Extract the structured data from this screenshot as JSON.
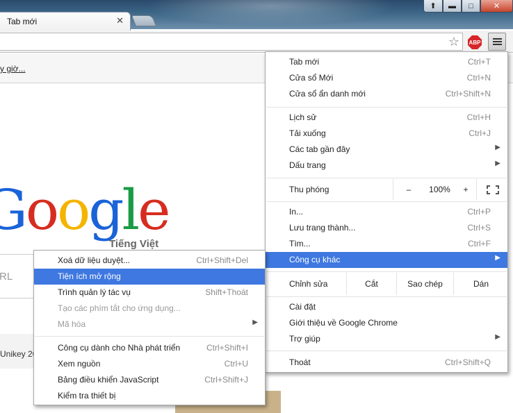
{
  "browser": {
    "tab_title": "Tab mới",
    "tab_close": "✕",
    "win_user": "⬆",
    "win_min": "▬",
    "win_max": "□",
    "win_close": "✕",
    "import_link": "y giờ...",
    "abp_label": "ABP"
  },
  "page": {
    "logo_sub": "Tiếng Việt",
    "search_placeholder": "RL",
    "mv_label": "Unikey 20"
  },
  "main_menu": {
    "items1": [
      {
        "label": "Tab mới",
        "shortcut": "Ctrl+T"
      },
      {
        "label": "Cửa sổ Mới",
        "shortcut": "Ctrl+N"
      },
      {
        "label": "Cửa sổ ẩn danh mới",
        "shortcut": "Ctrl+Shift+N"
      }
    ],
    "items2": [
      {
        "label": "Lịch sử",
        "shortcut": "Ctrl+H"
      },
      {
        "label": "Tải xuống",
        "shortcut": "Ctrl+J"
      },
      {
        "label": "Các tab gần đây",
        "shortcut": ""
      },
      {
        "label": "Dấu trang",
        "shortcut": ""
      }
    ],
    "zoom": {
      "label": "Thu phóng",
      "minus": "–",
      "value": "100%",
      "plus": "+"
    },
    "items3": [
      {
        "label": "In...",
        "shortcut": "Ctrl+P"
      },
      {
        "label": "Lưu trang thành...",
        "shortcut": "Ctrl+S"
      },
      {
        "label": "Tìm...",
        "shortcut": "Ctrl+F"
      },
      {
        "label": "Công cụ khác",
        "shortcut": ""
      }
    ],
    "edit": {
      "label": "Chỉnh sửa",
      "cut": "Cắt",
      "copy": "Sao chép",
      "paste": "Dán"
    },
    "items4": [
      {
        "label": "Cài đặt"
      },
      {
        "label": "Giới thiệu về Google Chrome"
      },
      {
        "label": "Trợ giúp"
      }
    ],
    "exit": {
      "label": "Thoát",
      "shortcut": "Ctrl+Shift+Q"
    }
  },
  "sub_menu": {
    "items1": [
      {
        "label": "Xoá dữ liệu duyệt...",
        "shortcut": "Ctrl+Shift+Del"
      },
      {
        "label": "Tiện ích mở rộng",
        "shortcut": ""
      },
      {
        "label": "Trình quản lý tác vụ",
        "shortcut": "Shift+Thoát"
      },
      {
        "label": "Tạo các phím tắt cho ứng dụng...",
        "shortcut": ""
      },
      {
        "label": "Mã hóa",
        "shortcut": ""
      }
    ],
    "items2": [
      {
        "label": "Công cụ dành cho Nhà phát triển",
        "shortcut": "Ctrl+Shift+I"
      },
      {
        "label": "Xem nguồn",
        "shortcut": "Ctrl+U"
      },
      {
        "label": "Bảng điều khiển JavaScript",
        "shortcut": "Ctrl+Shift+J"
      },
      {
        "label": "Kiểm tra thiết bị",
        "shortcut": ""
      }
    ]
  },
  "colors": {
    "highlight": "#3e78e0"
  }
}
